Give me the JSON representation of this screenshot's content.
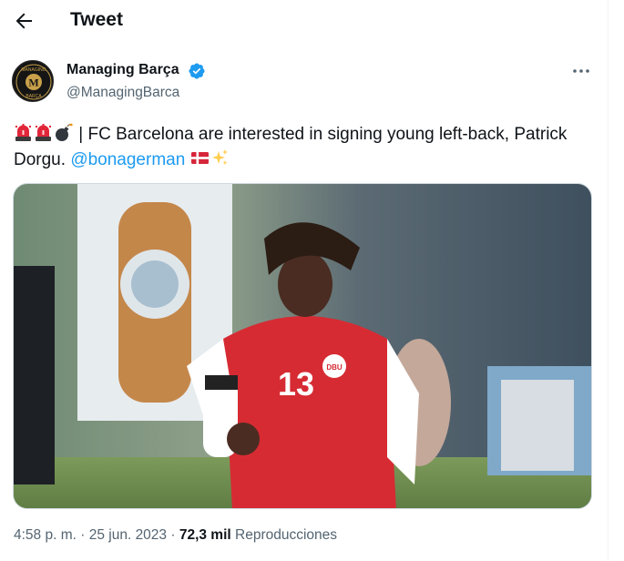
{
  "header": {
    "title": "Tweet",
    "back_icon": "arrow-left-icon"
  },
  "author": {
    "display_name": "Managing Barça",
    "handle": "@ManagingBarca",
    "avatar_letter": "M",
    "avatar_text_top": "MANAGING",
    "avatar_text_bottom": "BARÇA",
    "verified": true
  },
  "tweet": {
    "emojis_lead": [
      "rotating-light-icon",
      "rotating-light-icon",
      "bomb-icon"
    ],
    "text": "| FC Barcelona are interested in signing young left-back, Patrick Dorgu.",
    "mention": "@bonagerman",
    "emojis_trail": [
      "denmark-flag-icon",
      "sparkles-icon"
    ]
  },
  "media": {
    "jersey_number": "13",
    "description_badge": "DBU"
  },
  "meta": {
    "time": "4:58 p. m.",
    "separator": "·",
    "date": "25 jun. 2023",
    "views_count": "72,3 mil",
    "views_label": "Reproducciones"
  },
  "colors": {
    "accent": "#1d9bf0",
    "muted": "#536471",
    "text": "#0f1419",
    "jersey": "#d62b33"
  }
}
